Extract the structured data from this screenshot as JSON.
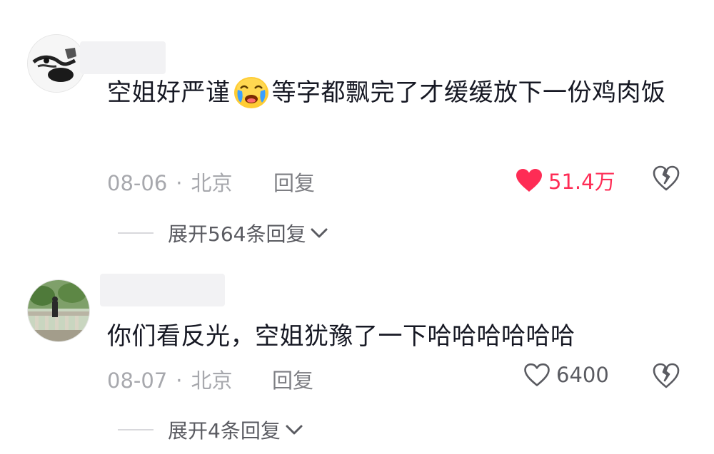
{
  "comments": [
    {
      "avatar": "avatar-ink-sketch",
      "text_before": "空姐好严谨",
      "emoji": "crying-face-emoji",
      "text_after": "等字都飘完了才缓缓放下一份鸡肉饭",
      "date": "08-06",
      "separator": "·",
      "location": "北京",
      "reply_label": "回复",
      "likes": "51.4万",
      "liked": true,
      "expand_label": "展开564条回复"
    },
    {
      "avatar": "avatar-landscape-photo",
      "text": "你们看反光，空姐犹豫了一下哈哈哈哈哈哈",
      "date": "08-07",
      "separator": "·",
      "location": "北京",
      "reply_label": "回复",
      "likes": "6400",
      "liked": false,
      "expand_label": "展开4条回复"
    }
  ],
  "colors": {
    "liked": "#fe2c55",
    "meta": "#a7a8ad",
    "text": "#161823"
  }
}
